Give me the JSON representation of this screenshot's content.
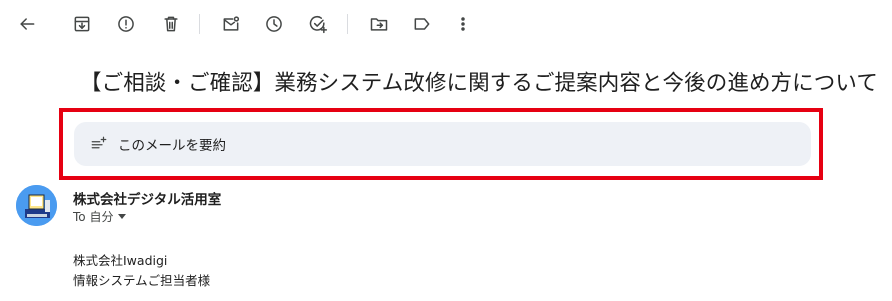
{
  "toolbar": {
    "icons": [
      "back-arrow-icon",
      "archive-icon",
      "report-spam-icon",
      "delete-icon",
      "mark-unread-icon",
      "snooze-icon",
      "add-to-tasks-icon",
      "move-to-icon",
      "label-icon",
      "more-vert-icon"
    ]
  },
  "email": {
    "subject": "【ご相談・ご確認】業務システム改修に関するご提案内容と今後の進め方について",
    "summary_label": "このメールを要約",
    "sender_name": "株式会社デジタル活用室",
    "to_label": "To 自分",
    "body_lines": [
      "株式会社Iwadigi",
      "情報システムご担当者様"
    ]
  },
  "colors": {
    "highlight_border": "#e60012",
    "summary_bg": "#eef1f6",
    "avatar_bg": "#4a9bf0"
  }
}
